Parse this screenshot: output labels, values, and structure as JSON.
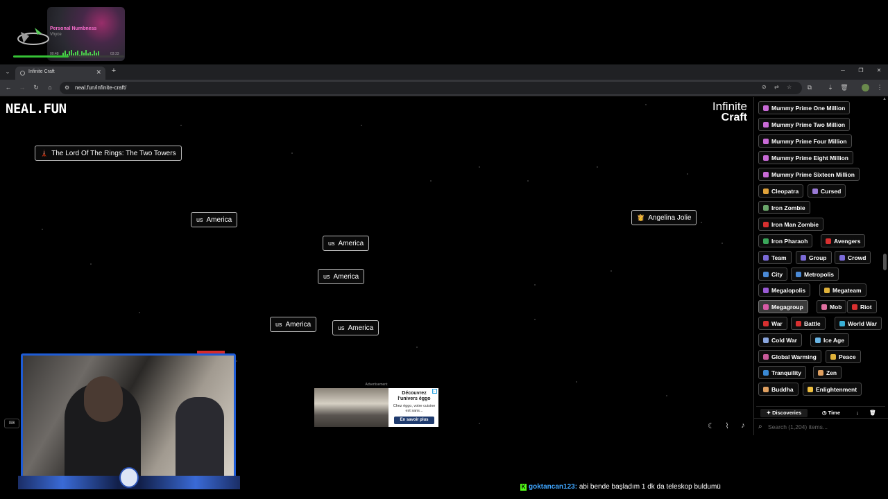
{
  "music": {
    "song": "Personal Numbness",
    "artist": "Vhyce",
    "elapsed": "00:48",
    "total": "03:33",
    "progress": 0.5
  },
  "browser": {
    "tab_title": "Infinite Craft",
    "url": "neal.fun/infinite-craft/"
  },
  "game": {
    "logo": "NEAL.FUN",
    "title_line1": "Infinite",
    "title_line2": "Craft",
    "canvas_items": [
      {
        "emoji": "🗼",
        "label": "The Lord Of The Rings: The Two Towers"
      },
      {
        "emoji": "us",
        "label": "America"
      },
      {
        "emoji": "👸",
        "label": "Angelina Jolie"
      },
      {
        "emoji": "us",
        "label": "America"
      },
      {
        "emoji": "us",
        "label": "America"
      },
      {
        "emoji": "us",
        "label": "America"
      },
      {
        "emoji": "us",
        "label": "America"
      }
    ],
    "ad": {
      "label": "Advertisement",
      "headline": "Découvrez l'univers éggo",
      "body": "Chez éggo, votre cuisine est sans...",
      "cta": "En savoir plus"
    }
  },
  "sidebar": {
    "items": [
      {
        "label": "Mummy Prime One Million",
        "color": "#c86ad6"
      },
      {
        "label": "Mummy Prime Two Million",
        "color": "#c86ad6"
      },
      {
        "label": "Mummy Prime Four Million",
        "color": "#c86ad6"
      },
      {
        "label": "Mummy Prime Eight Million",
        "color": "#c86ad6"
      },
      {
        "label": "Mummy Prime Sixteen Million",
        "color": "#c86ad6"
      },
      {
        "label": "Cleopatra",
        "color": "#e0a23a"
      },
      {
        "label": "Cursed",
        "color": "#9a7ad6"
      },
      {
        "label": "Iron Zombie",
        "color": "#6aa66a"
      },
      {
        "label": "Iron Man Zombie",
        "color": "#d83030"
      },
      {
        "label": "Iron Pharaoh",
        "color": "#3aa65a"
      },
      {
        "label": "Avengers",
        "color": "#d83030"
      },
      {
        "label": "Team",
        "color": "#7a6ad6"
      },
      {
        "label": "Group",
        "color": "#7a6ad6"
      },
      {
        "label": "Crowd",
        "color": "#7a6ad6"
      },
      {
        "label": "City",
        "color": "#4a8ad6"
      },
      {
        "label": "Metropolis",
        "color": "#4a8ad6"
      },
      {
        "label": "Megalopolis",
        "color": "#9a5ad6"
      },
      {
        "label": "Megateam",
        "color": "#e0b23a"
      },
      {
        "label": "Megagroup",
        "color": "#d85aa6"
      },
      {
        "label": "Mob",
        "color": "#e070a0"
      },
      {
        "label": "Riot",
        "color": "#d83030"
      },
      {
        "label": "War",
        "color": "#d83030"
      },
      {
        "label": "Battle",
        "color": "#d83030"
      },
      {
        "label": "World War",
        "color": "#3ab0d6"
      },
      {
        "label": "Cold War",
        "color": "#8aa6e0"
      },
      {
        "label": "Ice Age",
        "color": "#6ab6e6"
      },
      {
        "label": "Global Warming",
        "color": "#c85a9a"
      },
      {
        "label": "Peace",
        "color": "#e0b23a"
      },
      {
        "label": "Tranquility",
        "color": "#3a8ad6"
      },
      {
        "label": "Zen",
        "color": "#e0a060"
      },
      {
        "label": "Buddha",
        "color": "#e0a060"
      },
      {
        "label": "Enlightenment",
        "color": "#f0c040"
      }
    ],
    "selected": "Megagroup",
    "tab_discoveries": "Discoveries",
    "tab_time": "Time",
    "search_placeholder": "Search (1,204) items..."
  },
  "chat": {
    "user": "goktancan123:",
    "message": "abi bende başladım 1 dk da teleskop buldumü"
  }
}
